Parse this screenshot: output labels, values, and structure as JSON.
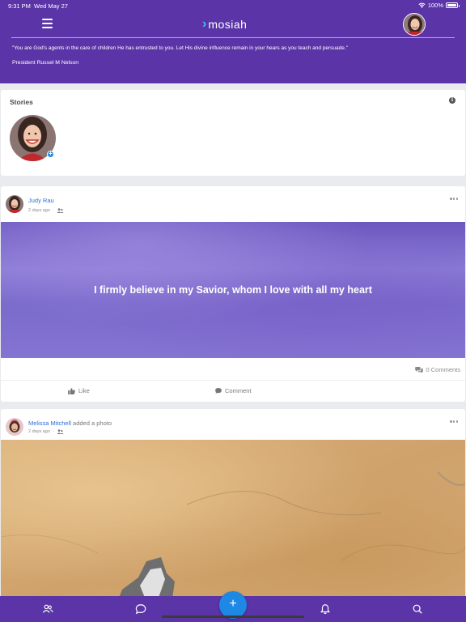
{
  "status_bar": {
    "time": "9:31 PM",
    "date": "Wed May 27",
    "battery": "100%"
  },
  "header": {
    "logo_text": "mosiah",
    "quote": "\"You are God's agents in the care of children He has entrusted to you. Let His divine influence remain in your hears as you teach and persuade.\"",
    "quote_author": "President Russel M Nelson"
  },
  "stories": {
    "title": "Stories"
  },
  "posts": [
    {
      "author": "Judy Rau",
      "action": "",
      "time": "2 days ago",
      "banner_text": "I firmly believe in my Savior, whom I love with all my heart",
      "comments": "0 Comments",
      "like_label": "Like",
      "comment_label": "Comment"
    },
    {
      "author": "Melissa Mitchell",
      "action": "added a photo",
      "time": "2 days ago"
    }
  ],
  "colors": {
    "brand": "#5b35a8",
    "accent": "#1e88e5",
    "link": "#2b6fd6",
    "logo_mark": "#3fc1f2"
  },
  "icons": {
    "header": [
      "menu-icon",
      "avatar"
    ],
    "bottom_nav": [
      "people-icon",
      "chat-icon",
      "add-icon",
      "bell-icon",
      "search-icon"
    ]
  }
}
